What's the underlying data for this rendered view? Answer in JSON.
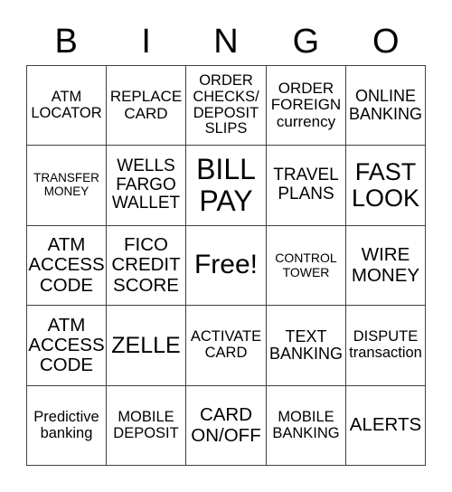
{
  "header": {
    "letters": [
      "B",
      "I",
      "N",
      "G",
      "O"
    ]
  },
  "board": {
    "rows": [
      [
        "ATM\nLOCATOR",
        "REPLACE\nCARD",
        "ORDER\nCHECKS/\nDEPOSIT\nSLIPS",
        "ORDER\nFOREIGN\ncurrency",
        "ONLINE\nBANKING"
      ],
      [
        "TRANSFER\nMONEY",
        "WELLS\nFARGO\nWALLET",
        "BILL\nPAY",
        "TRAVEL\nPLANS",
        "FAST\nLOOK"
      ],
      [
        "ATM\nACCESS\nCODE",
        "FICO\nCREDIT\nSCORE",
        "Free!",
        "CONTROL\nTOWER",
        "WIRE\nMONEY"
      ],
      [
        "ATM\nACCESS\nCODE",
        "ZELLE",
        "ACTIVATE\nCARD",
        "TEXT\nBANKING",
        "DISPUTE\ntransaction"
      ],
      [
        "Predictive\nbanking",
        "MOBILE\nDEPOSIT",
        "CARD\nON/OFF",
        "MOBILE\nBANKING",
        "ALERTS"
      ]
    ],
    "free_space": "Free!"
  },
  "colors": {
    "grid_line": "#404040",
    "text": "#000000",
    "background": "#ffffff"
  }
}
